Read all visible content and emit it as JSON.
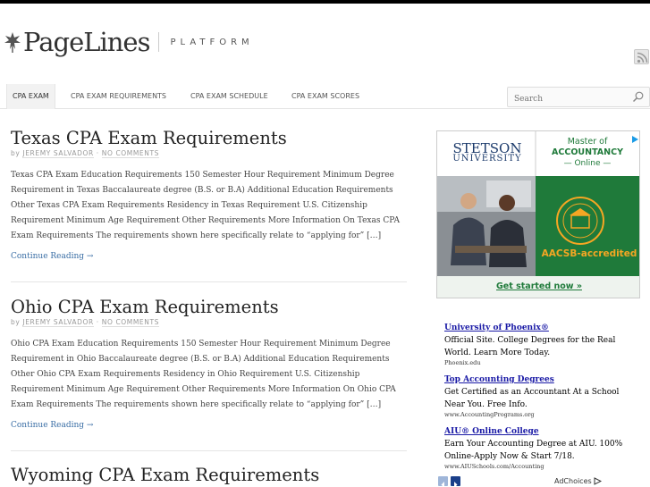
{
  "brand": {
    "name": "PageLines",
    "tagline": "PLATFORM"
  },
  "icons": {
    "rss": "rss-icon",
    "search": "search-icon",
    "arrow": "arrow-right-icon"
  },
  "nav": {
    "items": [
      {
        "label": "CPA EXAM"
      },
      {
        "label": "CPA EXAM REQUIREMENTS"
      },
      {
        "label": "CPA EXAM SCHEDULE"
      },
      {
        "label": "CPA EXAM SCORES"
      }
    ],
    "active_index": 0
  },
  "search": {
    "placeholder": "Search"
  },
  "posts": [
    {
      "title": "Texas CPA Exam Requirements",
      "by": "by",
      "author": "JEREMY SALVADOR",
      "dot": "·",
      "comments": "NO COMMENTS",
      "excerpt": "Texas CPA Exam Education Requirements 150 Semester Hour Requirement Minimum Degree Requirement in Texas Baccalaureate degree (B.S. or B.A) Additional Education Requirements Other Texas CPA Exam Requirements Residency in Texas Requirement U.S. Citizenship Requirement Minimum Age Requirement Other Requirements More Information On Texas CPA Exam Requirements The requirements shown here specifically relate to “applying for” […]",
      "continue": "Continue Reading →"
    },
    {
      "title": "Ohio CPA Exam Requirements",
      "by": "by",
      "author": "JEREMY SALVADOR",
      "dot": "·",
      "comments": "NO COMMENTS",
      "excerpt": "Ohio CPA Exam Education Requirements 150 Semester Hour Requirement Minimum Degree Requirement in Ohio Baccalaureate degree (B.S. or B.A) Additional Education Requirements Other Ohio CPA Exam Requirements Residency in Ohio Requirement U.S. Citizenship Requirement Minimum Age Requirement Other Requirements More Information On Ohio CPA Exam Requirements The requirements shown here specifically relate to “applying for” […]",
      "continue": "Continue Reading →"
    },
    {
      "title": "Wyoming CPA Exam Requirements"
    }
  ],
  "banner": {
    "school": "STETSON",
    "school_sub": "UNIVERSITY",
    "program_line1": "Master of",
    "program_line2": "ACCOUNTANCY",
    "program_line3": "— Online —",
    "accreditation": "AACSB-accredited",
    "cta": "Get started now »",
    "colors": {
      "green": "#1f7a3a",
      "navy": "#1b3a6b",
      "orange": "#f5a623"
    }
  },
  "text_ads": [
    {
      "title": "University of Phoenix®",
      "text": "Official Site. College Degrees for the Real World. Learn More Today.",
      "url": "Phoenix.edu"
    },
    {
      "title": "Top Accounting Degrees",
      "text": "Get Certified as an Accountant At a School Near You. Free Info.",
      "url": "www.AccountingPrograms.org"
    },
    {
      "title": "AIU® Online College",
      "text": "Earn Your Accounting Degree at AIU. 100% Online-Apply Now & Start 7/18.",
      "url": "www.AIUSchools.com/Accounting"
    }
  ],
  "adchoices": "AdChoices"
}
